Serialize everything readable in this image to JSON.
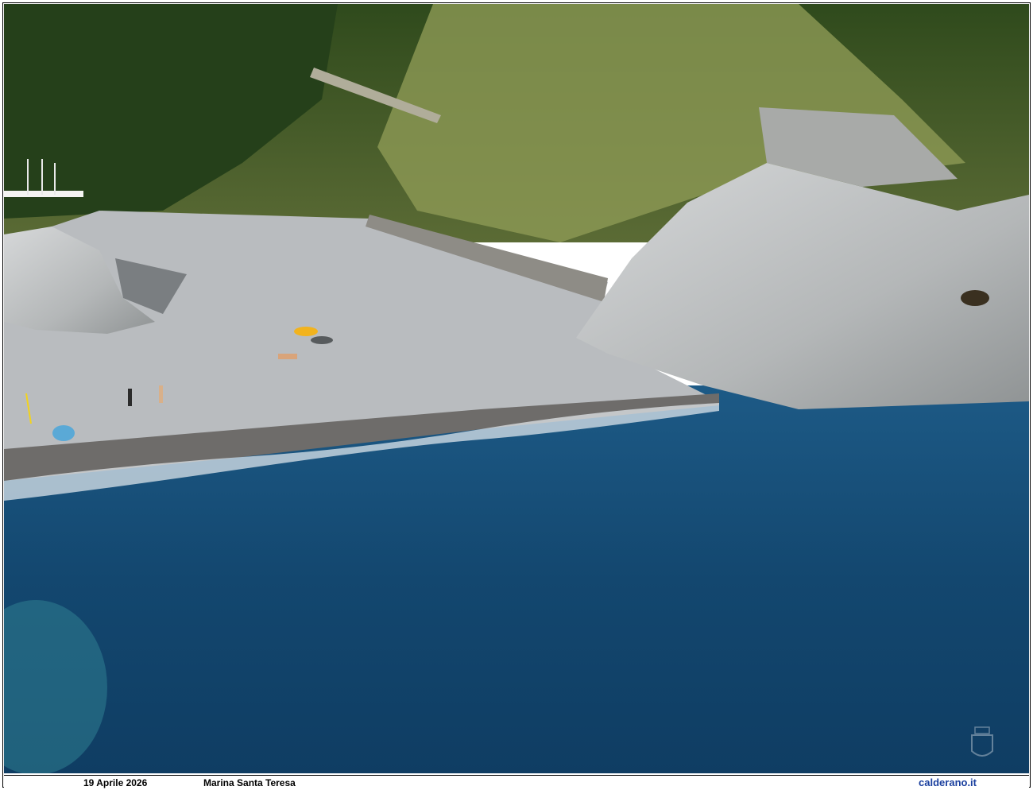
{
  "caption": {
    "date": "19 Aprile 2026",
    "location": "Marina Santa Teresa",
    "website": "calderano.it"
  },
  "photo": {
    "subject": "coastal-beach-aerial",
    "colors": {
      "sea_deep": "#0f3d63",
      "sea_mid": "#1d5a86",
      "sea_shallow": "#2f7f92",
      "beach": "#b9bcbf",
      "wet_sand": "#6e6c6a",
      "vegetation": "#3d5a24",
      "rock": "#c9cccd",
      "umbrella": "#f2b31d",
      "website_text": "#1a3f9e"
    },
    "watermark_icon": "crest-icon"
  }
}
